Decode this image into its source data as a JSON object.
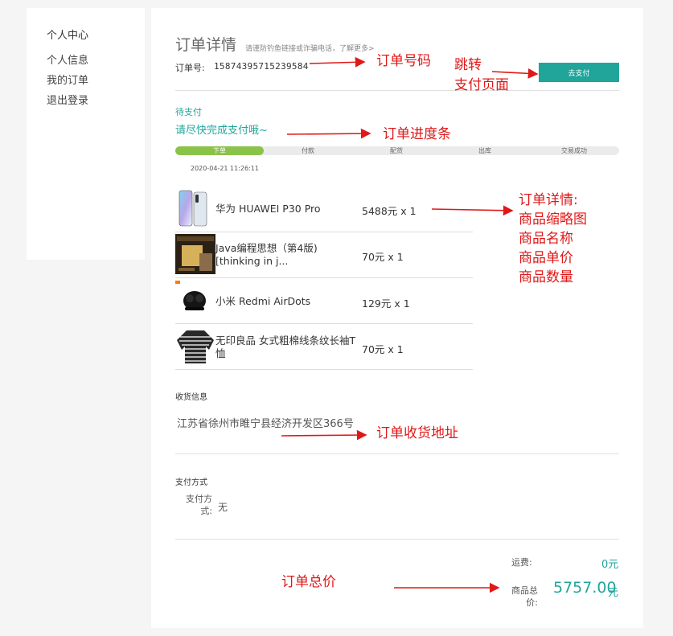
{
  "sidebar": {
    "title": "个人中心",
    "items": [
      "个人信息",
      "我的订单",
      "退出登录"
    ]
  },
  "order": {
    "title": "订单详情",
    "hint": "请谨防钓鱼链接或诈骗电话，了解更多>",
    "number_label": "订单号:",
    "number": "15874395715239584",
    "pay_button": "去支付",
    "status": "待支付",
    "status_message": "请尽快完成支付哦~",
    "progress": {
      "steps": [
        "下单",
        "付款",
        "配货",
        "出库",
        "交易成功"
      ],
      "completed_steps": 1,
      "time": "2020-04-21 11:26:11"
    }
  },
  "products": [
    {
      "name": "华为 HUAWEI P30 Pro",
      "price_qty": "5488元 x 1",
      "thumb_icon": "phone-thumbnail"
    },
    {
      "name": "Java编程思想（第4版) [thinking in j...",
      "price_qty": "70元 x 1",
      "thumb_icon": "book-thumbnail"
    },
    {
      "name": "小米 Redmi AirDots",
      "price_qty": "129元 x 1",
      "thumb_icon": "earbuds-thumbnail"
    },
    {
      "name": "无印良品 女式粗棉线条纹长袖T恤",
      "price_qty": "70元 x 1",
      "thumb_icon": "shirt-thumbnail"
    }
  ],
  "shipping": {
    "label": "收货信息",
    "address": "江苏省徐州市睢宁县经济开发区366号"
  },
  "payment": {
    "label": "支付方式",
    "key": "支付方式:",
    "value": "无"
  },
  "totals": {
    "fee_label": "运费:",
    "fee_value": "0元",
    "total_label": "商品总价:",
    "total_value": "5757.00",
    "total_unit": "元"
  },
  "annotations": {
    "order_number": "订单号码",
    "redirect_line1": "跳转",
    "redirect_line2": "支付页面",
    "progress_bar": "订单进度条",
    "details_lines": [
      "订单详情:",
      "商品缩略图",
      "商品名称",
      "商品单价",
      "商品数量"
    ],
    "address": "订单收货地址",
    "total": "订单总价"
  },
  "colors": {
    "accent": "#21a59b",
    "progress_done": "#8bc34a",
    "annotation": "#e01818"
  }
}
